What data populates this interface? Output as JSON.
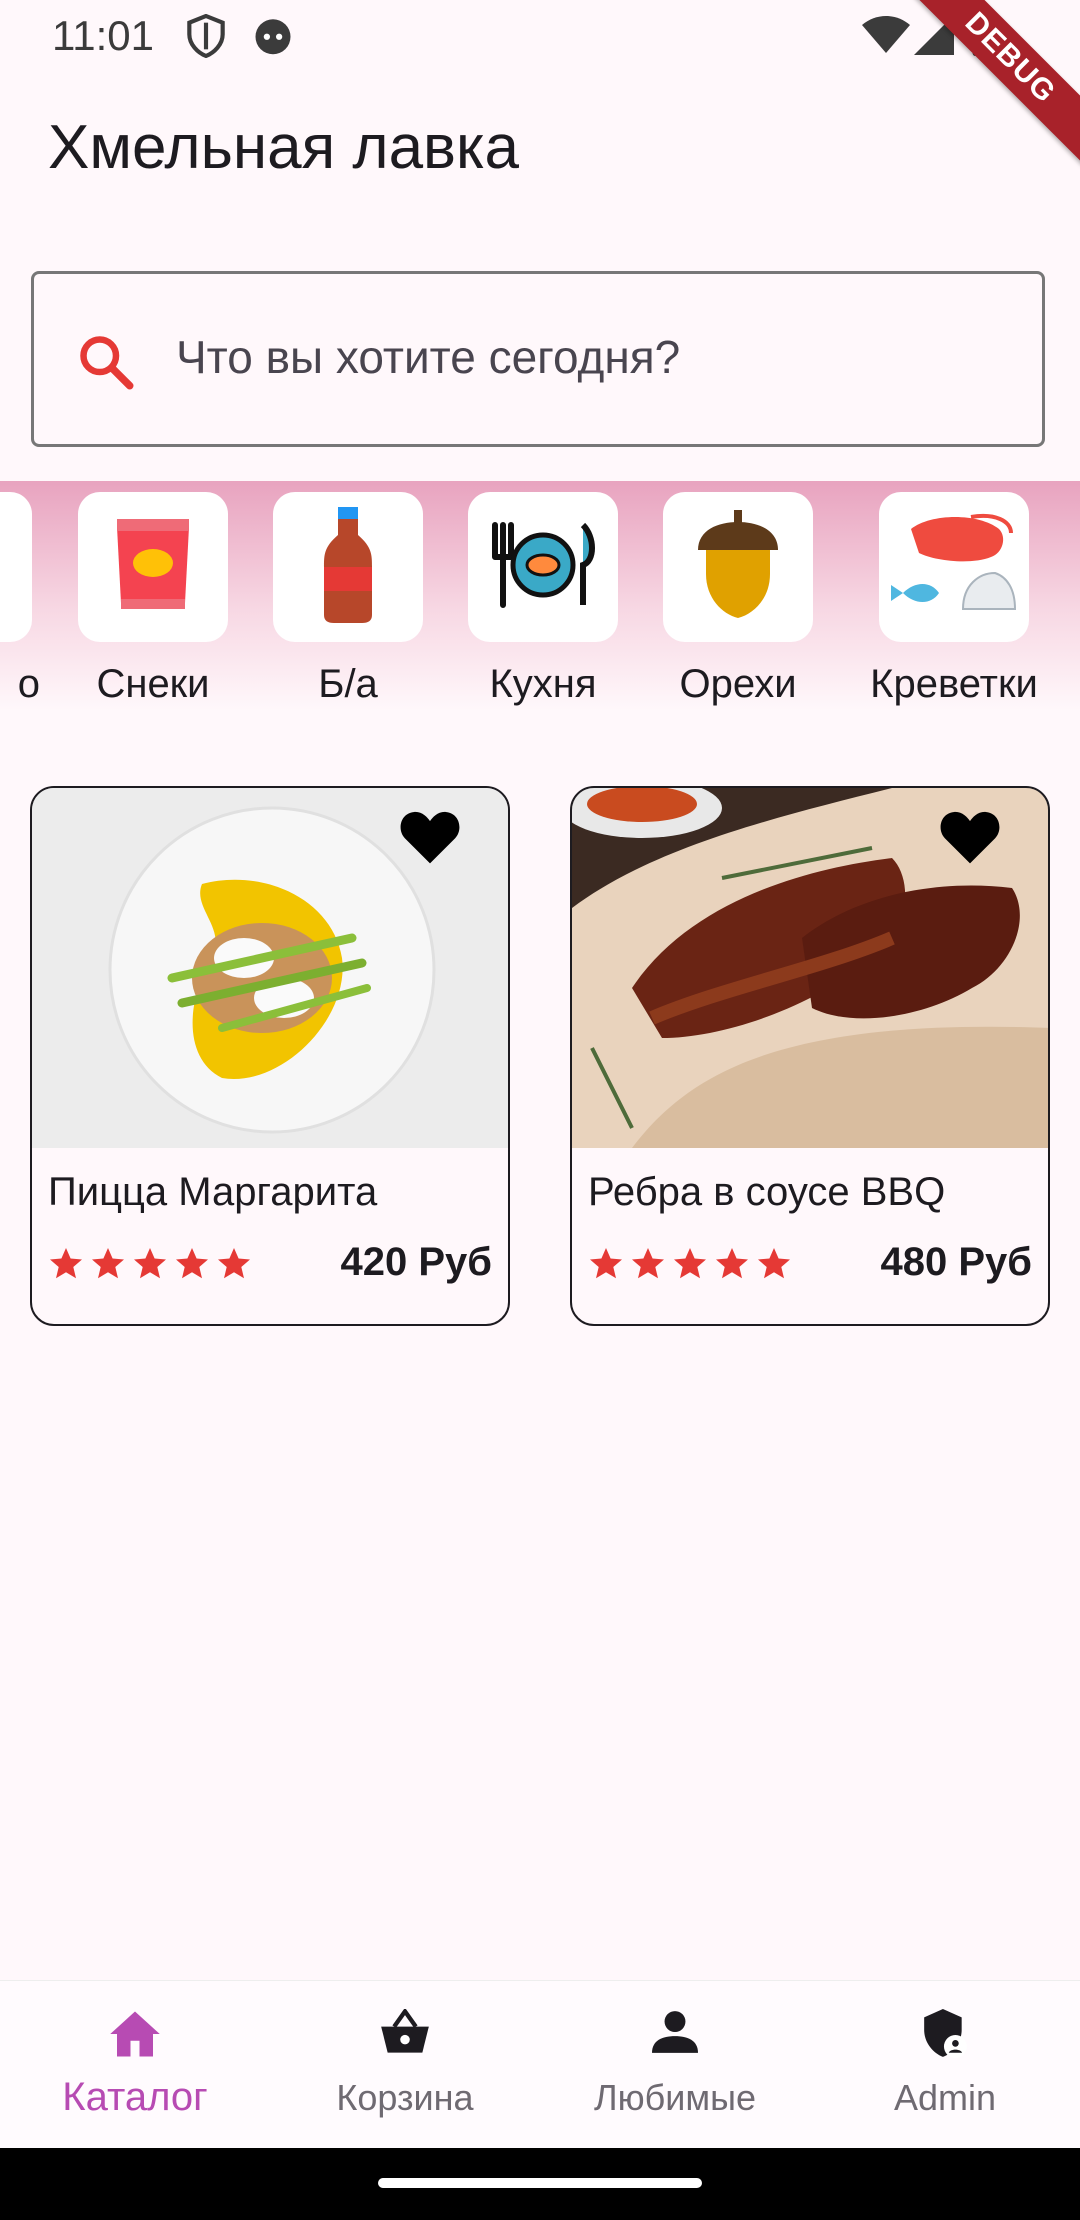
{
  "status_bar": {
    "time": "11:01",
    "debug_label": "DEBUG"
  },
  "app_bar": {
    "title": "Хмельная лавка"
  },
  "search": {
    "placeholder": "Что вы хотите сегодня?"
  },
  "categories": [
    {
      "label": "Снеки",
      "icon": "snack-bag-icon"
    },
    {
      "label": "Б/а",
      "icon": "soda-bottle-icon"
    },
    {
      "label": "Кухня",
      "icon": "kitchen-plate-icon"
    },
    {
      "label": "Орехи",
      "icon": "acorn-icon"
    },
    {
      "label": "Креветки",
      "icon": "shrimp-icon"
    }
  ],
  "products": [
    {
      "name": "Пицца Маргарита",
      "price": "420 Руб",
      "rating": 5
    },
    {
      "name": "Ребра в соусе BBQ",
      "price": "480 Руб",
      "rating": 5
    }
  ],
  "bottom_nav": [
    {
      "label": "Каталог",
      "icon": "home-icon",
      "active": true
    },
    {
      "label": "Корзина",
      "icon": "basket-icon",
      "active": false
    },
    {
      "label": "Любимые",
      "icon": "person-icon",
      "active": false
    },
    {
      "label": "Admin",
      "icon": "admin-shield-icon",
      "active": false
    }
  ],
  "colors": {
    "accent": "#b74bb3",
    "star": "#e53935",
    "search_icon": "#e53935",
    "debug": "#a8222a"
  }
}
